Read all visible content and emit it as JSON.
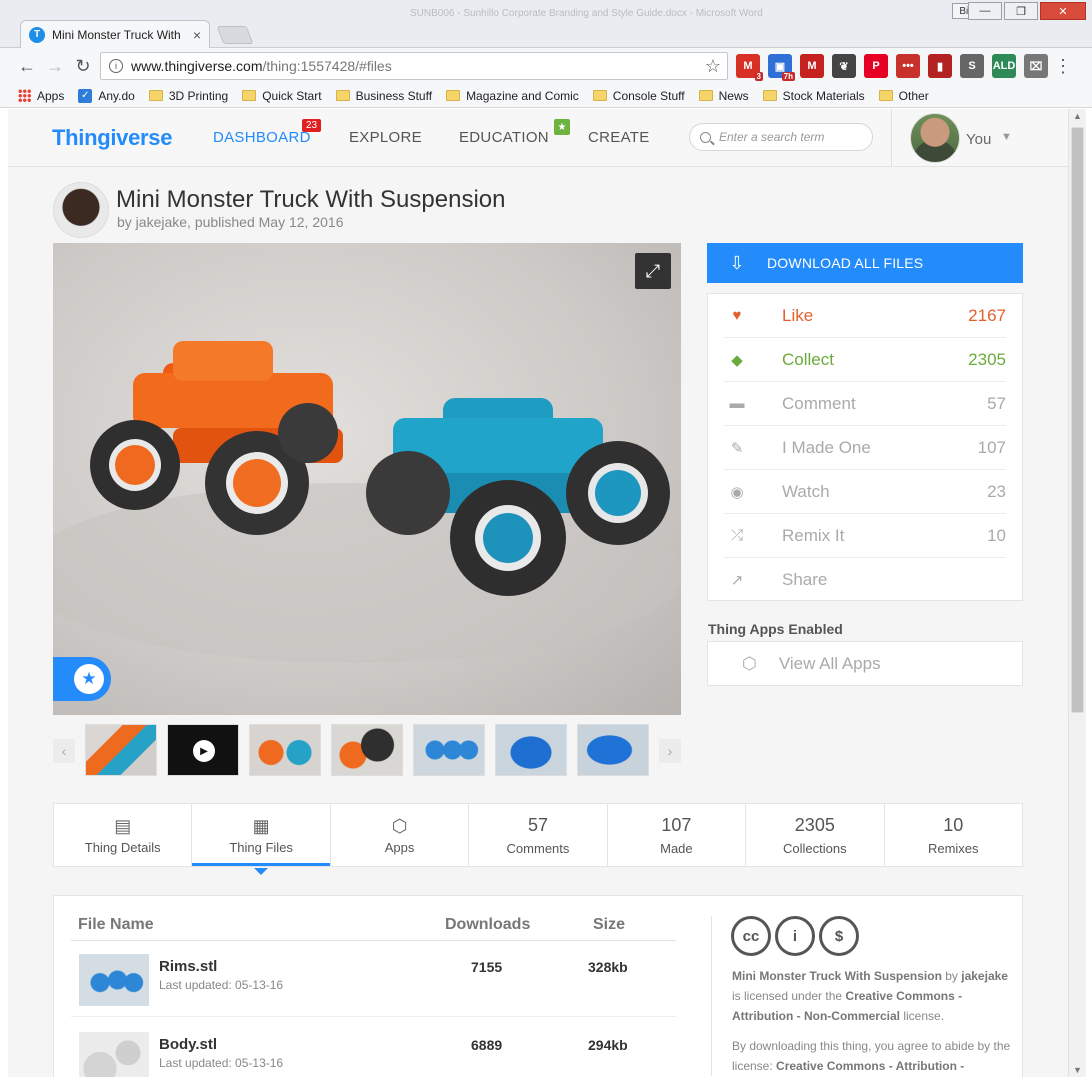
{
  "browser": {
    "titlebar_text": "SUNB006 - Sunhillo Corporate Branding and Style Guide.docx - Microsoft Word",
    "tab_title": "Mini Monster Truck With",
    "user_button": "Bill",
    "url_host": "www.thingiverse.com",
    "url_path": "/thing:1557428/#files",
    "extensions": [
      {
        "name": "gmail-icon",
        "label": "M",
        "color": "#d93025",
        "badge": "3"
      },
      {
        "name": "chat-icon",
        "label": "▣",
        "color": "#2f6fd6",
        "badge": "7h"
      },
      {
        "name": "gmail-alt-icon",
        "label": "M",
        "color": "#c5221f",
        "badge": ""
      },
      {
        "name": "evernote-icon",
        "label": "❦",
        "color": "#444",
        "badge": ""
      },
      {
        "name": "pinterest-icon",
        "label": "P",
        "color": "#e60023",
        "badge": ""
      },
      {
        "name": "lastpass-icon",
        "label": "•••",
        "color": "#c8302c",
        "badge": ""
      },
      {
        "name": "bookmark-ext-icon",
        "label": "▮",
        "color": "#b22222",
        "badge": ""
      },
      {
        "name": "shortcut-ext-icon",
        "label": "S",
        "color": "#666",
        "badge": ""
      },
      {
        "name": "ald-icon",
        "label": "ALD",
        "color": "#2e8b57",
        "badge": ""
      },
      {
        "name": "cast-icon",
        "label": "⌧",
        "color": "#777",
        "badge": ""
      }
    ],
    "bookmarks": [
      {
        "label": "Apps",
        "type": "apps"
      },
      {
        "label": "Any.do",
        "type": "check"
      },
      {
        "label": "3D Printing",
        "type": "folder"
      },
      {
        "label": "Quick Start",
        "type": "folder"
      },
      {
        "label": "Business Stuff",
        "type": "folder"
      },
      {
        "label": "Magazine and Comic",
        "type": "folder"
      },
      {
        "label": "Console Stuff",
        "type": "folder"
      },
      {
        "label": "News",
        "type": "folder"
      },
      {
        "label": "Stock Materials",
        "type": "folder"
      },
      {
        "label": "Other",
        "type": "folder"
      }
    ]
  },
  "header": {
    "logo": "Thingiverse",
    "nav": {
      "dashboard": "DASHBOARD",
      "dashboard_badge": "23",
      "explore": "EXPLORE",
      "education": "EDUCATION",
      "create": "CREATE"
    },
    "search_placeholder": "Enter a search term",
    "user_label": "You"
  },
  "thing": {
    "title": "Mini Monster Truck With Suspension",
    "byline": "by jakejake, published May 12, 2016"
  },
  "actions": {
    "download_label": "DOWNLOAD ALL FILES",
    "items": [
      {
        "key": "like",
        "icon": "heart-icon",
        "glyph": "♥",
        "label": "Like",
        "count": "2167"
      },
      {
        "key": "collect",
        "icon": "collect-icon",
        "glyph": "◆",
        "label": "Collect",
        "count": "2305"
      },
      {
        "key": "comment",
        "icon": "comment-icon",
        "glyph": "▬",
        "label": "Comment",
        "count": "57"
      },
      {
        "key": "made",
        "icon": "edit-icon",
        "glyph": "✎",
        "label": "I Made One",
        "count": "107"
      },
      {
        "key": "watch",
        "icon": "eye-icon",
        "glyph": "◉",
        "label": "Watch",
        "count": "23"
      },
      {
        "key": "remix",
        "icon": "shuffle-icon",
        "glyph": "⤮",
        "label": "Remix It",
        "count": "10"
      },
      {
        "key": "share",
        "icon": "share-icon",
        "glyph": "↗",
        "label": "Share",
        "count": ""
      }
    ],
    "apps_title": "Thing Apps Enabled",
    "view_all_apps": "View All Apps"
  },
  "stats": [
    {
      "name": "tab-thing-details",
      "icon": "▤",
      "number": "",
      "label": "Thing Details",
      "active": false
    },
    {
      "name": "tab-thing-files",
      "icon": "▦",
      "number": "",
      "label": "Thing Files",
      "active": true
    },
    {
      "name": "tab-apps",
      "icon": "⬡",
      "number": "",
      "label": "Apps",
      "active": false
    },
    {
      "name": "tab-comments",
      "icon": "",
      "number": "57",
      "label": "Comments",
      "active": false
    },
    {
      "name": "tab-made",
      "icon": "",
      "number": "107",
      "label": "Made",
      "active": false
    },
    {
      "name": "tab-collections",
      "icon": "",
      "number": "2305",
      "label": "Collections",
      "active": false
    },
    {
      "name": "tab-remixes",
      "icon": "",
      "number": "10",
      "label": "Remixes",
      "active": false
    }
  ],
  "files": {
    "headers": {
      "name": "File Name",
      "downloads": "Downloads",
      "size": "Size"
    },
    "rows": [
      {
        "name": "Rims.stl",
        "updated": "Last updated: 05-13-16",
        "downloads": "7155",
        "size": "328kb"
      },
      {
        "name": "Body.stl",
        "updated": "Last updated: 05-13-16",
        "downloads": "6889",
        "size": "294kb"
      }
    ]
  },
  "license": {
    "badges": [
      "cc",
      "i",
      "$"
    ],
    "thing_name": "Mini Monster Truck With Suspension",
    "by": " by ",
    "author": "jakejake",
    "licensed_text": " is licensed under the ",
    "license_name": "Creative Commons - Attribution - Non-Commercial",
    "license_suffix": " license.",
    "abide_text": "By downloading this thing, you agree to abide by the license: ",
    "abide_license": "Creative Commons - Attribution -"
  }
}
